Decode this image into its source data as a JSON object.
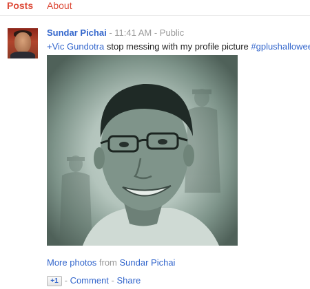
{
  "tabs": {
    "posts": "Posts",
    "about": "About"
  },
  "post": {
    "author": "Sundar Pichai",
    "time": "11:41 AM",
    "visibility": "Public",
    "separator": " - ",
    "mention": "+Vic Gundotra",
    "text": " stop messing with my profile picture ",
    "hashtag": "#gplushalloween"
  },
  "photo_footer": {
    "more_photos": "More photos",
    "from": " from ",
    "author": "Sundar Pichai"
  },
  "actions": {
    "plus_one": "+1",
    "comment": "Comment",
    "share": "Share"
  },
  "colors": {
    "link": "#3366cc",
    "tab_active": "#dd4b39",
    "meta": "#999999"
  }
}
